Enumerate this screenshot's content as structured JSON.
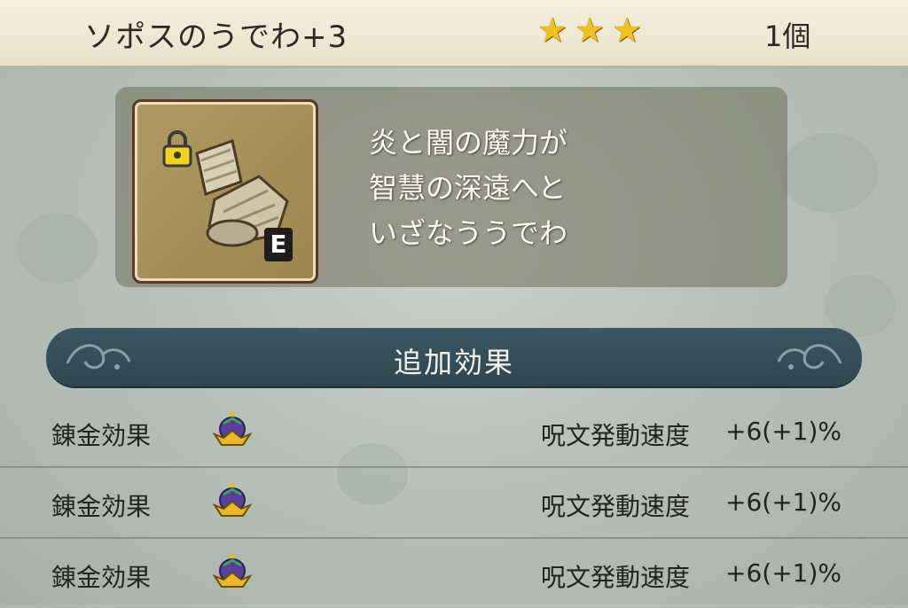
{
  "header": {
    "item_name": "ソポスのうでわ+3",
    "stars": 3,
    "count": "1個"
  },
  "item": {
    "icon": "bracelet-icon",
    "locked": true,
    "equip_badge": "E",
    "description": [
      "炎と闇の魔力が",
      "智慧の深遠へと",
      "いざなううでわ"
    ]
  },
  "section": {
    "title": "追加効果"
  },
  "effects": [
    {
      "label": "錬金効果",
      "icon": "crown-icon",
      "effect": "呪文発動速度",
      "value": "+6(+1)%"
    },
    {
      "label": "錬金効果",
      "icon": "crown-icon",
      "effect": "呪文発動速度",
      "value": "+6(+1)%"
    },
    {
      "label": "錬金効果",
      "icon": "crown-icon",
      "effect": "呪文発動速度",
      "value": "+6(+1)%"
    }
  ],
  "colors": {
    "star": "#f3c21a",
    "section_bar": "#34505a",
    "header": "#f0ebd6"
  }
}
